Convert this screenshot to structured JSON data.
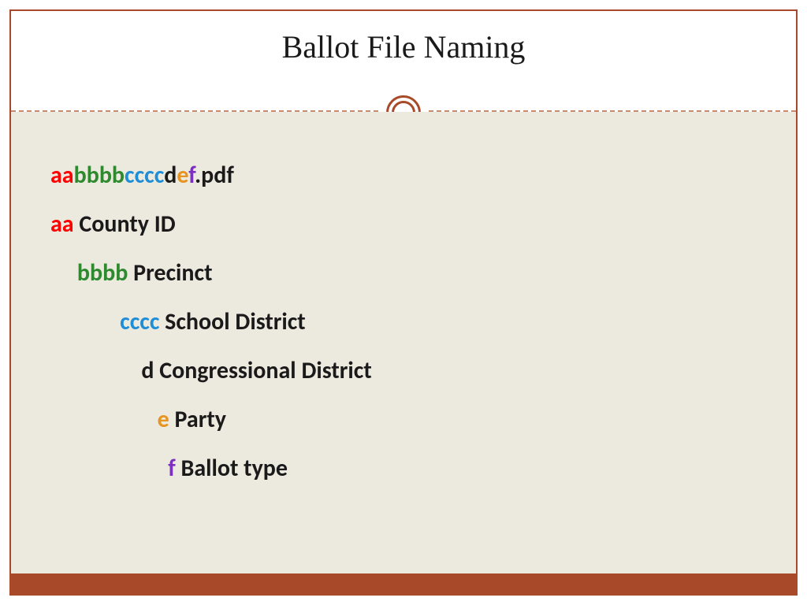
{
  "title": "Ballot File Naming",
  "pattern": {
    "aa": "aa",
    "bbbb": "bbbb",
    "cccc": "cccc",
    "d": "d",
    "e": "e",
    "f": "f",
    "ext": ".pdf"
  },
  "legend": {
    "aa": {
      "code": "aa",
      "label": " County ID",
      "indent": ""
    },
    "bbbb": {
      "code": "bbbb",
      "label": " Precinct",
      "indent": "     "
    },
    "cccc": {
      "code": "cccc",
      "label": " School District",
      "indent": "             "
    },
    "d": {
      "code": "d",
      "label": " Congressional District",
      "indent": "                 "
    },
    "e": {
      "code": "e",
      "label": " Party",
      "indent": "                    "
    },
    "f": {
      "code": "f",
      "label": " Ballot type",
      "indent": "                      "
    }
  }
}
